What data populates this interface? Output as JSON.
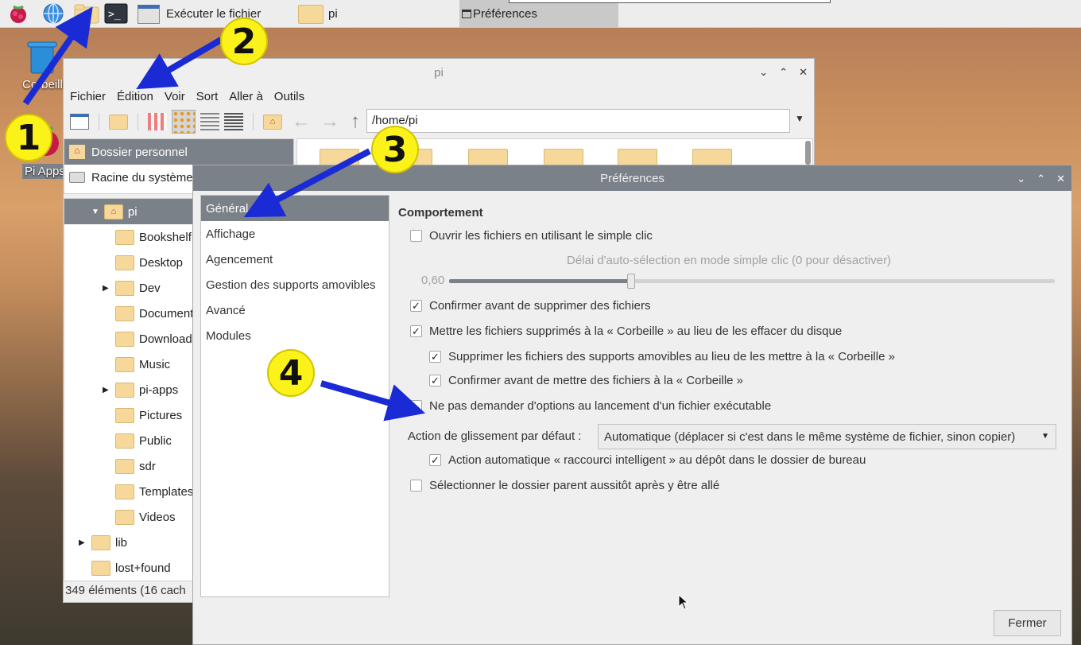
{
  "taskbar": {
    "run_label": "Exécuter le fichier",
    "pi_window_label": "pi",
    "prefs_window_label": "Préférences"
  },
  "desktop": {
    "trash_label": "Corbeille",
    "piapps_label": "Pi Apps"
  },
  "filemanager": {
    "title": "pi",
    "menu": [
      "Fichier",
      "Édition",
      "Voir",
      "Sort",
      "Aller à",
      "Outils"
    ],
    "path": "/home/pi",
    "places": [
      "Dossier personnel",
      "Racine du système"
    ],
    "tree_root": "pi",
    "tree": [
      "Bookshelf",
      "Desktop",
      "Dev",
      "Documents",
      "Downloads",
      "Music",
      "pi-apps",
      "Pictures",
      "Public",
      "sdr",
      "Templates",
      "Videos"
    ],
    "tree_extra": [
      "lib",
      "lost+found"
    ],
    "status": "349 éléments (16 cach"
  },
  "preferences": {
    "title": "Préférences",
    "categories": [
      "Général",
      "Affichage",
      "Agencement",
      "Gestion des supports amovibles",
      "Avancé",
      "Modules"
    ],
    "section": "Comportement",
    "single_click": "Ouvrir les fichiers en utilisant le simple clic",
    "delay_label": "Délai d'auto-sélection en mode simple clic (0 pour désactiver)",
    "delay_value": "0,60",
    "delay_fraction": 0.3,
    "confirm_delete": "Confirmer avant de supprimer des fichiers",
    "use_trash": "Mettre les fichiers supprimés à la « Corbeille » au lieu de les effacer du disque",
    "removable_trash": "Supprimer les fichiers des supports amovibles au lieu de les mettre à la « Corbeille »",
    "confirm_trash": "Confirmer avant de mettre des fichiers à la « Corbeille »",
    "no_exec_prompt": "Ne pas demander d'options au lancement d'un fichier exécutable",
    "drag_label": "Action de glissement par défaut :",
    "drag_value": "Automatique (déplacer si c'est dans le même système de fichier, sinon copier)",
    "smart_shortcut": "Action automatique « raccourci intelligent » au dépôt dans le dossier de bureau",
    "select_parent": "Sélectionner le dossier parent aussitôt après y être allé",
    "close_button": "Fermer"
  },
  "badges": [
    "1",
    "2",
    "3",
    "4"
  ],
  "colors": {
    "selection": "#7b8188",
    "badge": "#fbf21a",
    "arrow": "#1a2bd6"
  }
}
